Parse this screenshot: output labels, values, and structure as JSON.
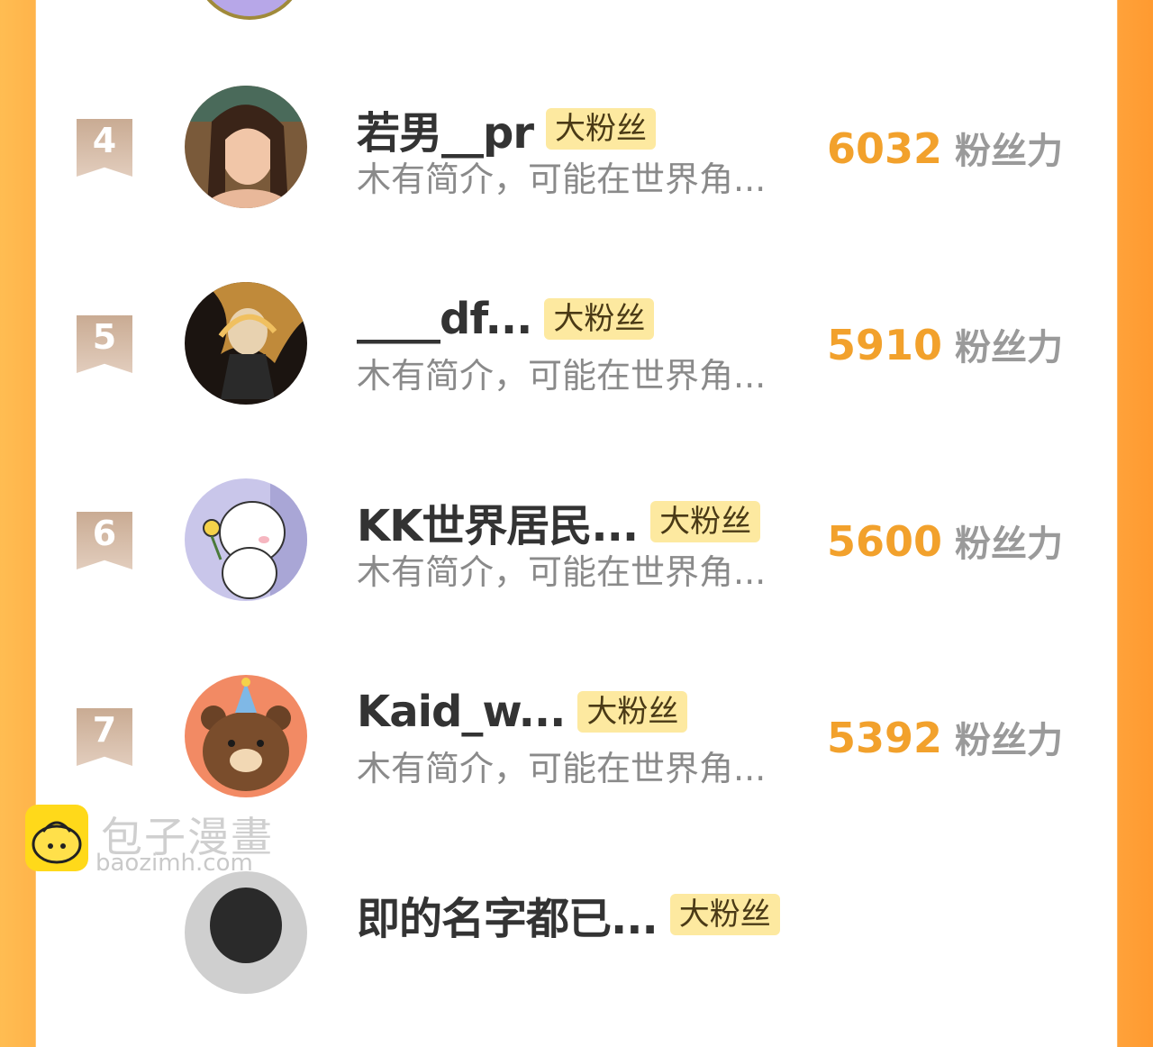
{
  "entries": [
    {
      "rank": "4",
      "name": "若男__pr",
      "badge": "大粉丝",
      "intro": "木有简介，可能在世界角...",
      "score": "6032",
      "score_label": "粉丝力"
    },
    {
      "rank": "5",
      "name": "____df...",
      "badge": "大粉丝",
      "intro": "木有简介，可能在世界角...",
      "score": "5910",
      "score_label": "粉丝力"
    },
    {
      "rank": "6",
      "name": "KK世界居民...",
      "badge": "大粉丝",
      "intro": "木有简介，可能在世界角...",
      "score": "5600",
      "score_label": "粉丝力"
    },
    {
      "rank": "7",
      "name": "Kaid_w...",
      "badge": "大粉丝",
      "intro": "木有简介，可能在世界角...",
      "score": "5392",
      "score_label": "粉丝力"
    },
    {
      "name": "即的名字都已...",
      "badge": "大粉丝"
    }
  ],
  "watermark": {
    "title": "包子漫畫",
    "url": "baozimh.com"
  },
  "colors": {
    "accent": "#f2a12c",
    "badge_bg": "#fde9a0",
    "frame": "#ffb34a"
  }
}
